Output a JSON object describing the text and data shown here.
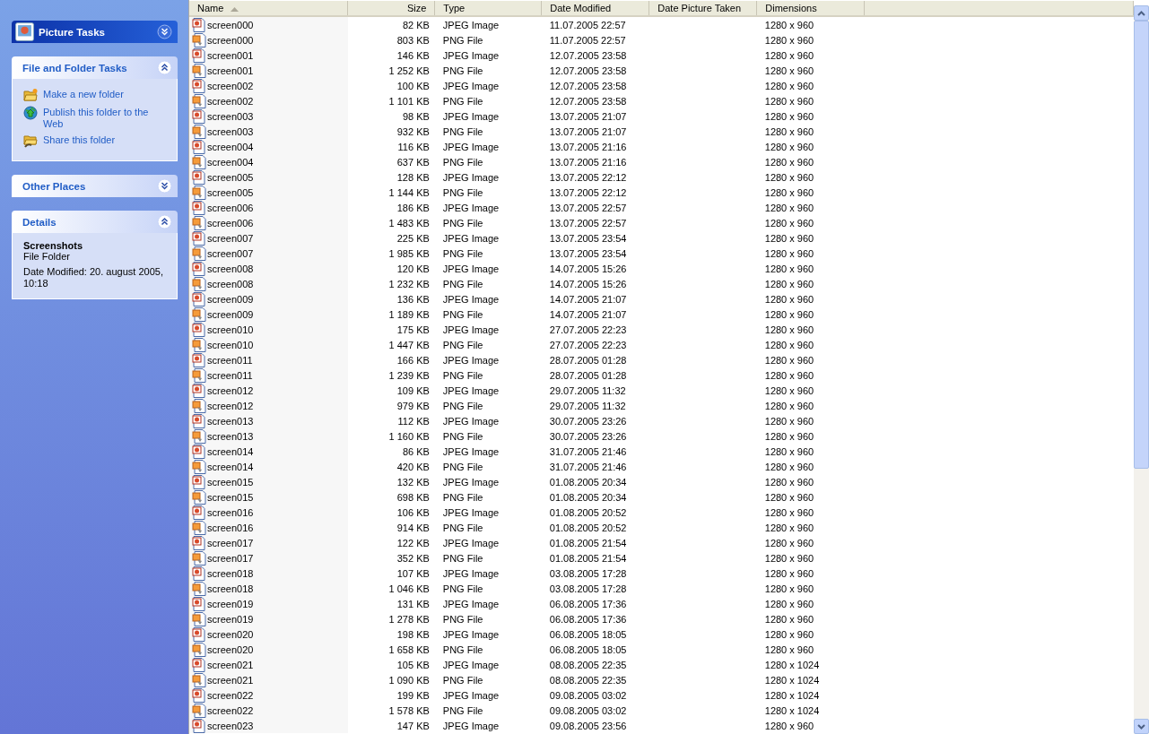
{
  "sidebar": {
    "panels": [
      {
        "title": "Picture Tasks",
        "kind": "special",
        "expanded": false
      },
      {
        "title": "File and Folder Tasks",
        "kind": "normal",
        "expanded": true,
        "tasks": [
          {
            "label": "Make a new folder",
            "kind": "folder"
          },
          {
            "label": "Publish this folder to the Web",
            "kind": "globe"
          },
          {
            "label": "Share this folder",
            "kind": "share"
          }
        ]
      },
      {
        "title": "Other Places",
        "kind": "normal",
        "expanded": false
      },
      {
        "title": "Details",
        "kind": "normal",
        "expanded": true,
        "details": {
          "name": "Screenshots",
          "type": "File Folder",
          "date_modified": "Date Modified: 20. august 2005, 10:18"
        }
      }
    ]
  },
  "table": {
    "columns": [
      {
        "label": "Name",
        "sorted": true
      },
      {
        "label": "Size",
        "sorted": false
      },
      {
        "label": "Type",
        "sorted": false
      },
      {
        "label": "Date Modified",
        "sorted": false
      },
      {
        "label": "Date Picture Taken",
        "sorted": false
      },
      {
        "label": "Dimensions",
        "sorted": false
      }
    ],
    "rows": [
      {
        "kind": "jpeg",
        "cells": [
          "screen000",
          "82 KB",
          "JPEG Image",
          "11.07.2005 22:57",
          "",
          "1280 x 960"
        ]
      },
      {
        "kind": "png",
        "cells": [
          "screen000",
          "803 KB",
          "PNG File",
          "11.07.2005 22:57",
          "",
          "1280 x 960"
        ]
      },
      {
        "kind": "jpeg",
        "cells": [
          "screen001",
          "146 KB",
          "JPEG Image",
          "12.07.2005 23:58",
          "",
          "1280 x 960"
        ]
      },
      {
        "kind": "png",
        "cells": [
          "screen001",
          "1 252 KB",
          "PNG File",
          "12.07.2005 23:58",
          "",
          "1280 x 960"
        ]
      },
      {
        "kind": "jpeg",
        "cells": [
          "screen002",
          "100 KB",
          "JPEG Image",
          "12.07.2005 23:58",
          "",
          "1280 x 960"
        ]
      },
      {
        "kind": "png",
        "cells": [
          "screen002",
          "1 101 KB",
          "PNG File",
          "12.07.2005 23:58",
          "",
          "1280 x 960"
        ]
      },
      {
        "kind": "jpeg",
        "cells": [
          "screen003",
          "98 KB",
          "JPEG Image",
          "13.07.2005 21:07",
          "",
          "1280 x 960"
        ]
      },
      {
        "kind": "png",
        "cells": [
          "screen003",
          "932 KB",
          "PNG File",
          "13.07.2005 21:07",
          "",
          "1280 x 960"
        ]
      },
      {
        "kind": "jpeg",
        "cells": [
          "screen004",
          "116 KB",
          "JPEG Image",
          "13.07.2005 21:16",
          "",
          "1280 x 960"
        ]
      },
      {
        "kind": "png",
        "cells": [
          "screen004",
          "637 KB",
          "PNG File",
          "13.07.2005 21:16",
          "",
          "1280 x 960"
        ]
      },
      {
        "kind": "jpeg",
        "cells": [
          "screen005",
          "128 KB",
          "JPEG Image",
          "13.07.2005 22:12",
          "",
          "1280 x 960"
        ]
      },
      {
        "kind": "png",
        "cells": [
          "screen005",
          "1 144 KB",
          "PNG File",
          "13.07.2005 22:12",
          "",
          "1280 x 960"
        ]
      },
      {
        "kind": "jpeg",
        "cells": [
          "screen006",
          "186 KB",
          "JPEG Image",
          "13.07.2005 22:57",
          "",
          "1280 x 960"
        ]
      },
      {
        "kind": "png",
        "cells": [
          "screen006",
          "1 483 KB",
          "PNG File",
          "13.07.2005 22:57",
          "",
          "1280 x 960"
        ]
      },
      {
        "kind": "jpeg",
        "cells": [
          "screen007",
          "225 KB",
          "JPEG Image",
          "13.07.2005 23:54",
          "",
          "1280 x 960"
        ]
      },
      {
        "kind": "png",
        "cells": [
          "screen007",
          "1 985 KB",
          "PNG File",
          "13.07.2005 23:54",
          "",
          "1280 x 960"
        ]
      },
      {
        "kind": "jpeg",
        "cells": [
          "screen008",
          "120 KB",
          "JPEG Image",
          "14.07.2005 15:26",
          "",
          "1280 x 960"
        ]
      },
      {
        "kind": "png",
        "cells": [
          "screen008",
          "1 232 KB",
          "PNG File",
          "14.07.2005 15:26",
          "",
          "1280 x 960"
        ]
      },
      {
        "kind": "jpeg",
        "cells": [
          "screen009",
          "136 KB",
          "JPEG Image",
          "14.07.2005 21:07",
          "",
          "1280 x 960"
        ]
      },
      {
        "kind": "png",
        "cells": [
          "screen009",
          "1 189 KB",
          "PNG File",
          "14.07.2005 21:07",
          "",
          "1280 x 960"
        ]
      },
      {
        "kind": "jpeg",
        "cells": [
          "screen010",
          "175 KB",
          "JPEG Image",
          "27.07.2005 22:23",
          "",
          "1280 x 960"
        ]
      },
      {
        "kind": "png",
        "cells": [
          "screen010",
          "1 447 KB",
          "PNG File",
          "27.07.2005 22:23",
          "",
          "1280 x 960"
        ]
      },
      {
        "kind": "jpeg",
        "cells": [
          "screen011",
          "166 KB",
          "JPEG Image",
          "28.07.2005 01:28",
          "",
          "1280 x 960"
        ]
      },
      {
        "kind": "png",
        "cells": [
          "screen011",
          "1 239 KB",
          "PNG File",
          "28.07.2005 01:28",
          "",
          "1280 x 960"
        ]
      },
      {
        "kind": "jpeg",
        "cells": [
          "screen012",
          "109 KB",
          "JPEG Image",
          "29.07.2005 11:32",
          "",
          "1280 x 960"
        ]
      },
      {
        "kind": "png",
        "cells": [
          "screen012",
          "979 KB",
          "PNG File",
          "29.07.2005 11:32",
          "",
          "1280 x 960"
        ]
      },
      {
        "kind": "jpeg",
        "cells": [
          "screen013",
          "112 KB",
          "JPEG Image",
          "30.07.2005 23:26",
          "",
          "1280 x 960"
        ]
      },
      {
        "kind": "png",
        "cells": [
          "screen013",
          "1 160 KB",
          "PNG File",
          "30.07.2005 23:26",
          "",
          "1280 x 960"
        ]
      },
      {
        "kind": "jpeg",
        "cells": [
          "screen014",
          "86 KB",
          "JPEG Image",
          "31.07.2005 21:46",
          "",
          "1280 x 960"
        ]
      },
      {
        "kind": "png",
        "cells": [
          "screen014",
          "420 KB",
          "PNG File",
          "31.07.2005 21:46",
          "",
          "1280 x 960"
        ]
      },
      {
        "kind": "jpeg",
        "cells": [
          "screen015",
          "132 KB",
          "JPEG Image",
          "01.08.2005 20:34",
          "",
          "1280 x 960"
        ]
      },
      {
        "kind": "png",
        "cells": [
          "screen015",
          "698 KB",
          "PNG File",
          "01.08.2005 20:34",
          "",
          "1280 x 960"
        ]
      },
      {
        "kind": "jpeg",
        "cells": [
          "screen016",
          "106 KB",
          "JPEG Image",
          "01.08.2005 20:52",
          "",
          "1280 x 960"
        ]
      },
      {
        "kind": "png",
        "cells": [
          "screen016",
          "914 KB",
          "PNG File",
          "01.08.2005 20:52",
          "",
          "1280 x 960"
        ]
      },
      {
        "kind": "jpeg",
        "cells": [
          "screen017",
          "122 KB",
          "JPEG Image",
          "01.08.2005 21:54",
          "",
          "1280 x 960"
        ]
      },
      {
        "kind": "png",
        "cells": [
          "screen017",
          "352 KB",
          "PNG File",
          "01.08.2005 21:54",
          "",
          "1280 x 960"
        ]
      },
      {
        "kind": "jpeg",
        "cells": [
          "screen018",
          "107 KB",
          "JPEG Image",
          "03.08.2005 17:28",
          "",
          "1280 x 960"
        ]
      },
      {
        "kind": "png",
        "cells": [
          "screen018",
          "1 046 KB",
          "PNG File",
          "03.08.2005 17:28",
          "",
          "1280 x 960"
        ]
      },
      {
        "kind": "jpeg",
        "cells": [
          "screen019",
          "131 KB",
          "JPEG Image",
          "06.08.2005 17:36",
          "",
          "1280 x 960"
        ]
      },
      {
        "kind": "png",
        "cells": [
          "screen019",
          "1 278 KB",
          "PNG File",
          "06.08.2005 17:36",
          "",
          "1280 x 960"
        ]
      },
      {
        "kind": "jpeg",
        "cells": [
          "screen020",
          "198 KB",
          "JPEG Image",
          "06.08.2005 18:05",
          "",
          "1280 x 960"
        ]
      },
      {
        "kind": "png",
        "cells": [
          "screen020",
          "1 658 KB",
          "PNG File",
          "06.08.2005 18:05",
          "",
          "1280 x 960"
        ]
      },
      {
        "kind": "jpeg",
        "cells": [
          "screen021",
          "105 KB",
          "JPEG Image",
          "08.08.2005 22:35",
          "",
          "1280 x 1024"
        ]
      },
      {
        "kind": "png",
        "cells": [
          "screen021",
          "1 090 KB",
          "PNG File",
          "08.08.2005 22:35",
          "",
          "1280 x 1024"
        ]
      },
      {
        "kind": "jpeg",
        "cells": [
          "screen022",
          "199 KB",
          "JPEG Image",
          "09.08.2005 03:02",
          "",
          "1280 x 1024"
        ]
      },
      {
        "kind": "png",
        "cells": [
          "screen022",
          "1 578 KB",
          "PNG File",
          "09.08.2005 03:02",
          "",
          "1280 x 1024"
        ]
      },
      {
        "kind": "jpeg",
        "cells": [
          "screen023",
          "147 KB",
          "JPEG Image",
          "09.08.2005 23:56",
          "",
          "1280 x 960"
        ]
      }
    ]
  }
}
